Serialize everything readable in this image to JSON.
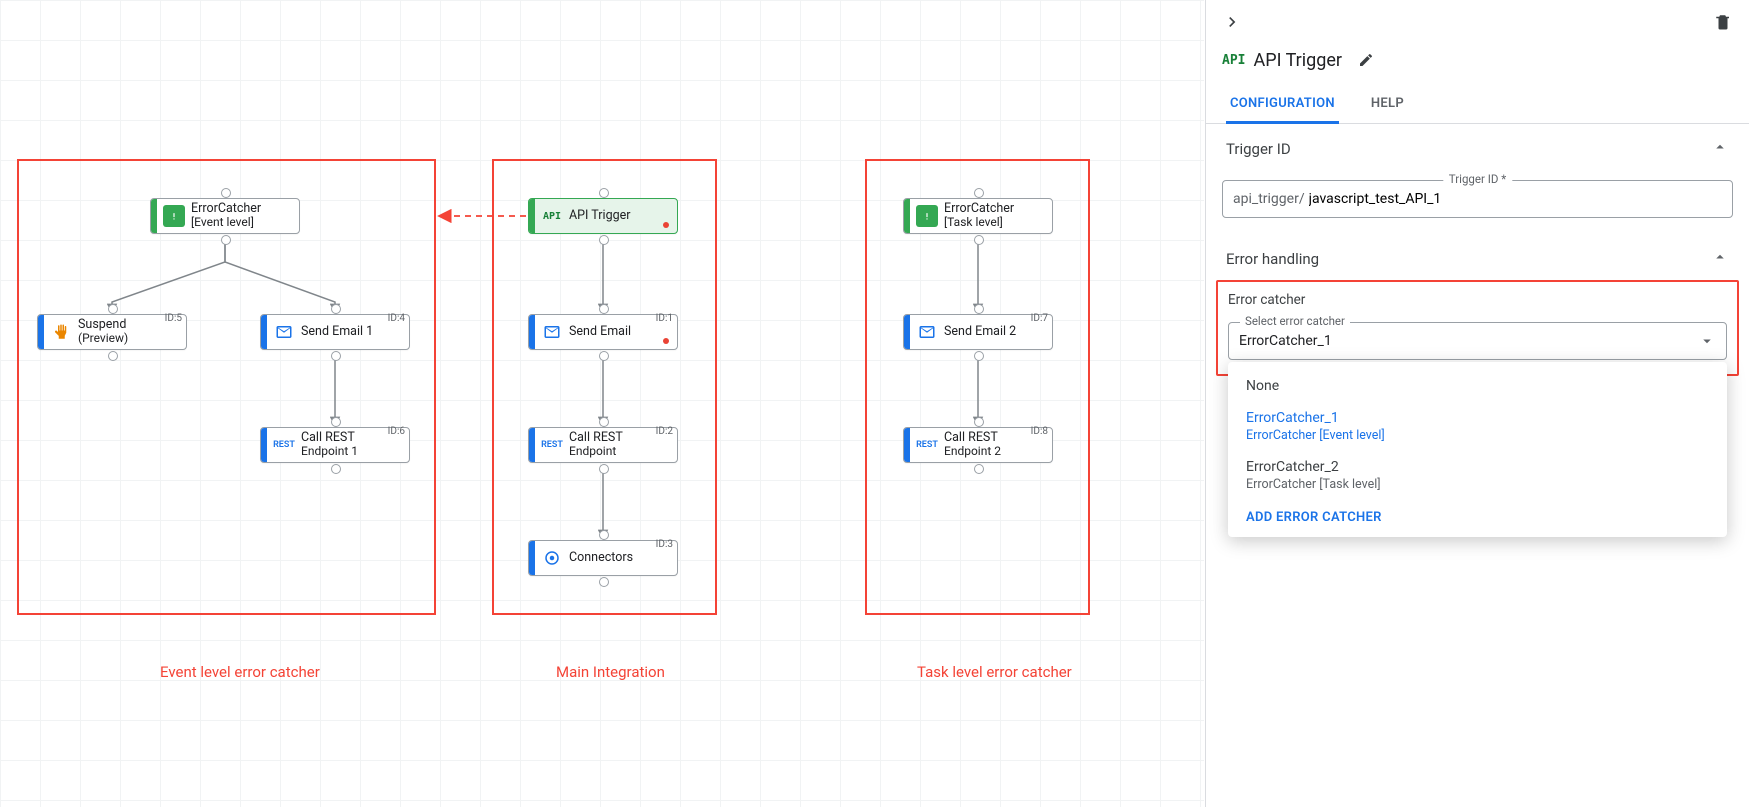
{
  "canvas": {
    "sections": {
      "event": {
        "caption": "Event level error catcher"
      },
      "main": {
        "caption": "Main Integration"
      },
      "task": {
        "caption": "Task level error catcher"
      }
    },
    "nodes": {
      "event_root": {
        "line1": "ErrorCatcher",
        "line2": "[Event level]"
      },
      "suspend": {
        "line1": "Suspend",
        "line2": "(Preview)",
        "id": "ID:5"
      },
      "send_email_1": {
        "line1": "Send Email 1",
        "id": "ID:4"
      },
      "rest_1": {
        "line1": "Call REST",
        "line2": "Endpoint 1",
        "id": "ID:6"
      },
      "api_trigger": {
        "line1": "API Trigger"
      },
      "send_email": {
        "line1": "Send Email",
        "id": "ID:1"
      },
      "rest": {
        "line1": "Call REST",
        "line2": "Endpoint",
        "id": "ID:2"
      },
      "connectors": {
        "line1": "Connectors",
        "id": "ID:3"
      },
      "task_root": {
        "line1": "ErrorCatcher",
        "line2": "[Task level]"
      },
      "send_email_2": {
        "line1": "Send Email 2",
        "id": "ID:7"
      },
      "rest_2": {
        "line1": "Call REST",
        "line2": "Endpoint 2",
        "id": "ID:8"
      }
    }
  },
  "panel": {
    "title": "API Trigger",
    "tabs": {
      "configuration": "CONFIGURATION",
      "help": "HELP"
    },
    "sections": {
      "trigger_id": {
        "header": "Trigger ID",
        "field_label": "Trigger ID *",
        "prefix": "api_trigger/",
        "value": "javascript_test_API_1"
      },
      "error_handling": {
        "header": "Error handling",
        "block_title": "Error catcher",
        "select_label": "Select error catcher",
        "selected": "ErrorCatcher_1",
        "options": {
          "none": "None",
          "opt1": {
            "title": "ErrorCatcher_1",
            "subtitle": "ErrorCatcher [Event level]"
          },
          "opt2": {
            "title": "ErrorCatcher_2",
            "subtitle": "ErrorCatcher [Task level]"
          }
        },
        "add_label": "ADD ERROR CATCHER"
      }
    }
  }
}
